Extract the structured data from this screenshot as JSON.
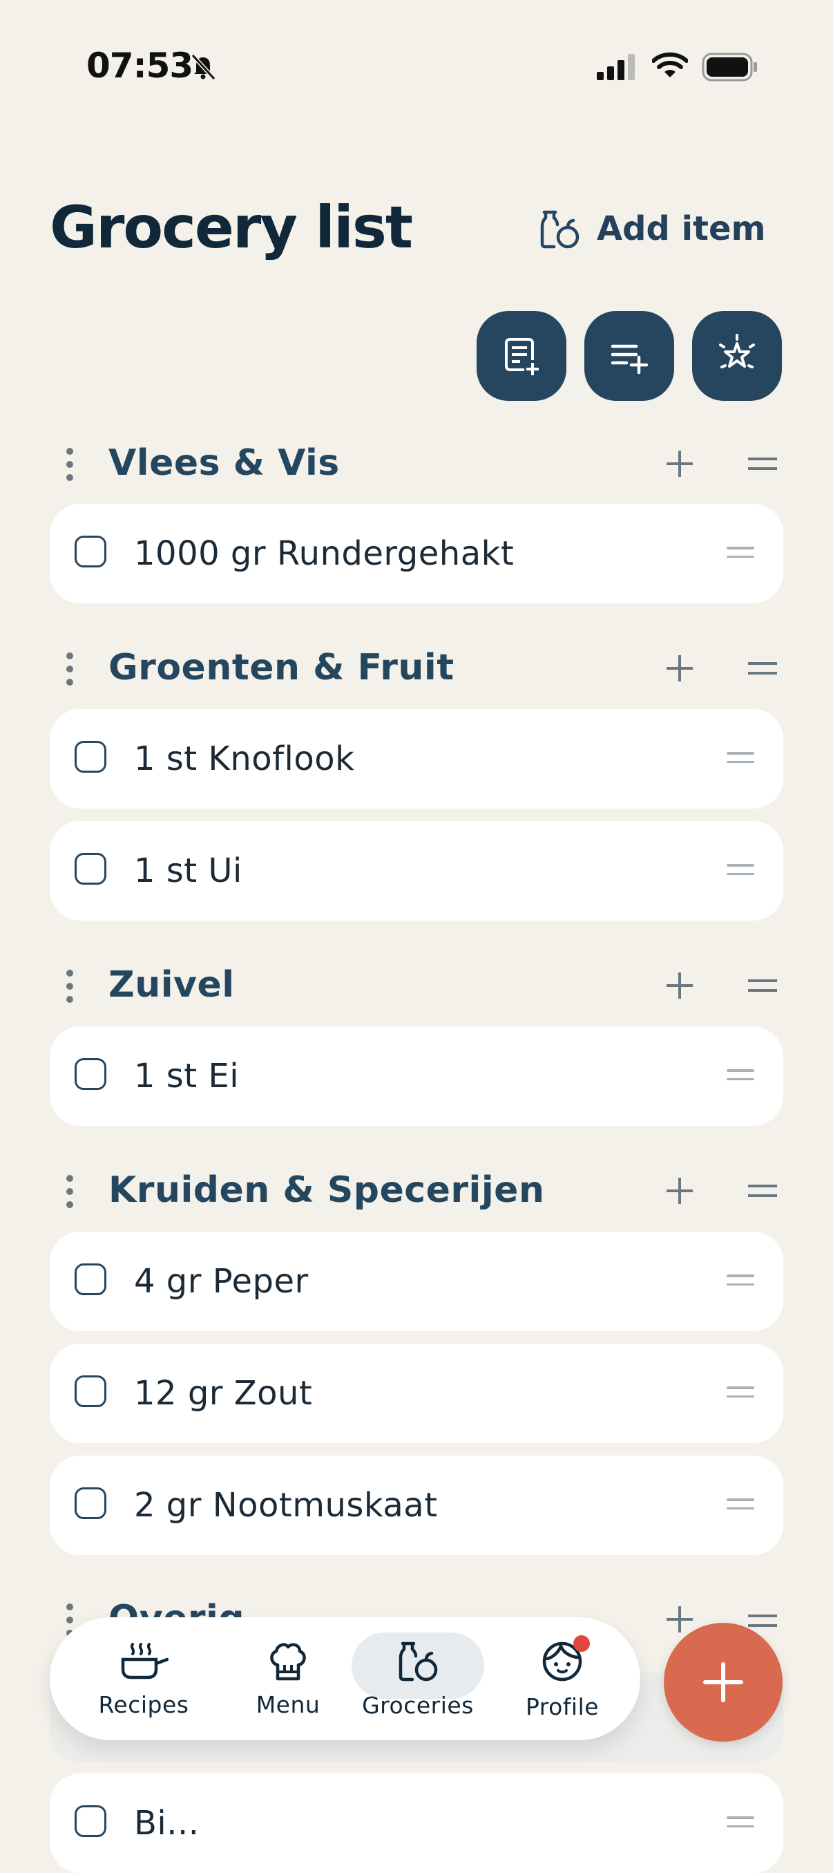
{
  "status_bar": {
    "time": "07:53"
  },
  "header": {
    "title": "Grocery list",
    "add_item_label": "Add item"
  },
  "toolbar": {
    "buttons": [
      "add-list-icon",
      "add-to-list-icon",
      "sparkle-icon"
    ]
  },
  "categories": [
    {
      "title": "Vlees & Vis",
      "items": [
        "1000 gr Rundergehakt"
      ]
    },
    {
      "title": "Groenten & Fruit",
      "items": [
        "1 st Knoflook",
        "1 st Ui"
      ]
    },
    {
      "title": "Zuivel",
      "items": [
        "1 st Ei"
      ]
    },
    {
      "title": "Kruiden & Specerijen",
      "items": [
        "4 gr Peper",
        "12 gr Zout",
        "2 gr Nootmuskaat"
      ]
    },
    {
      "title": "Overig",
      "items": [
        "Bi..."
      ]
    }
  ],
  "nav": {
    "items": [
      {
        "label": "Recipes",
        "icon": "pan-icon"
      },
      {
        "label": "Menu",
        "icon": "chef-hat-icon"
      },
      {
        "label": "Groceries",
        "icon": "groceries-icon",
        "active": true
      },
      {
        "label": "Profile",
        "icon": "face-icon",
        "badge": true
      }
    ]
  },
  "colors": {
    "background": "#f3f1ea",
    "primary": "#26465f",
    "accent": "#d9694f"
  }
}
